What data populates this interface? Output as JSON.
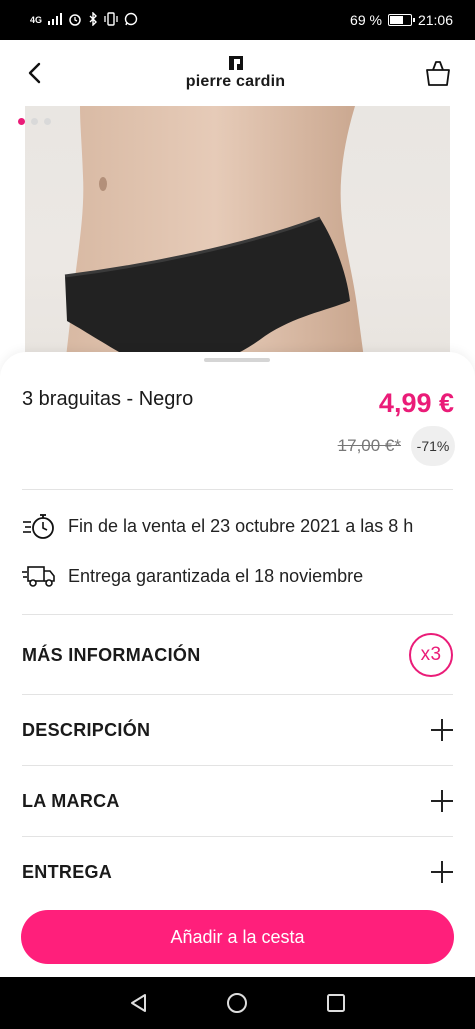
{
  "status_bar": {
    "network": "4G",
    "battery_text": "69 %",
    "battery_level": 0.69,
    "time": "21:06"
  },
  "header": {
    "brand": "pierre cardin",
    "back_icon": "chevron-left-icon",
    "bag_icon": "shopping-bag-icon"
  },
  "gallery": {
    "image_count": 3,
    "active_index": 0
  },
  "product": {
    "title": "3 braguitas - Negro",
    "price": "4,99 €",
    "old_price": "17,00 €*",
    "discount": "-71%"
  },
  "info": [
    {
      "icon": "stopwatch-icon",
      "text": "Fin de la venta el 23 octubre 2021 a las 8 h"
    },
    {
      "icon": "delivery-truck-icon",
      "text": "Entrega garantizada el 18 noviembre"
    }
  ],
  "sections": {
    "more_info": {
      "label": "MÁS INFORMACIÓN",
      "badge": "x3"
    },
    "description": {
      "label": "DESCRIPCIÓN"
    },
    "brand": {
      "label": "LA MARCA"
    },
    "delivery": {
      "label": "ENTREGA"
    }
  },
  "cta": {
    "label": "Añadir a la cesta"
  },
  "colors": {
    "accent": "#ea1c78",
    "cta": "#ff1f7b",
    "text": "#1a1a1a"
  }
}
